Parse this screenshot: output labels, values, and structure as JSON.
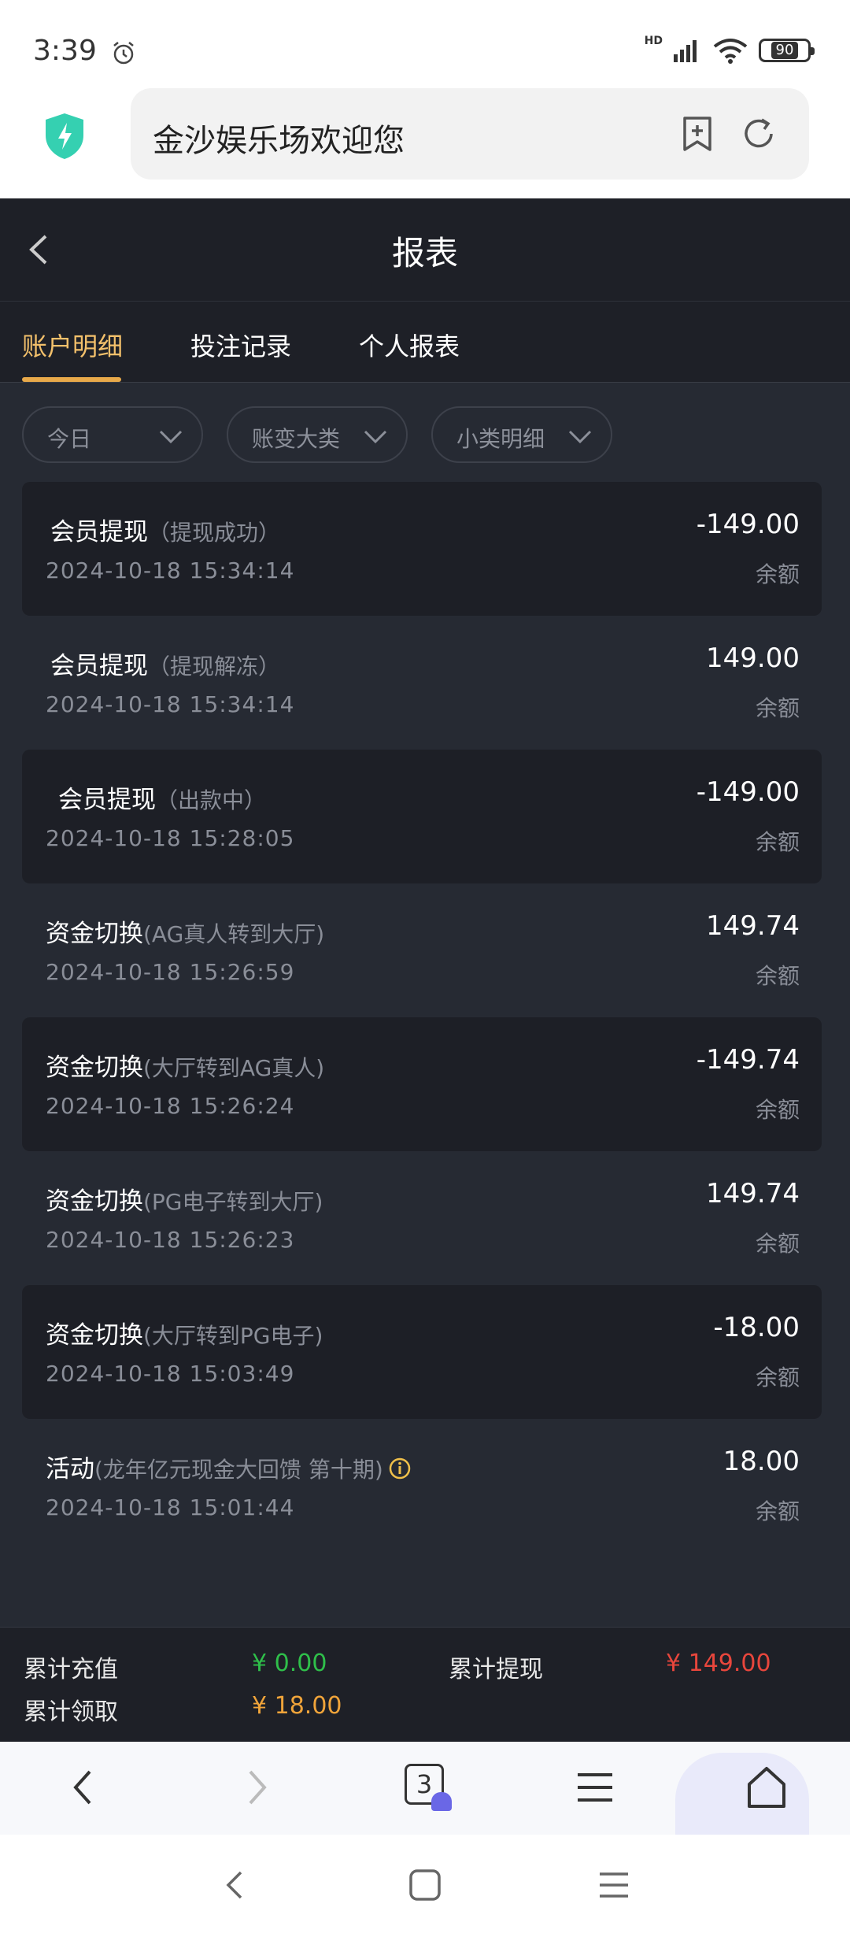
{
  "status_bar": {
    "time": "3:39",
    "network": "HD",
    "battery": "90"
  },
  "browser": {
    "address": "金沙娱乐场欢迎您",
    "tab_count": "3"
  },
  "header": {
    "title": "报表"
  },
  "tabs": [
    {
      "label": "账户明细",
      "active": true
    },
    {
      "label": "投注记录",
      "active": false
    },
    {
      "label": "个人报表",
      "active": false
    }
  ],
  "filters": [
    {
      "label": "今日"
    },
    {
      "label": "账变大类"
    },
    {
      "label": "小类明细"
    }
  ],
  "records": [
    {
      "title": "会员提现",
      "sub": "（提现成功）",
      "time": "2024-10-18 15:34:14",
      "amount": "-149.00",
      "balance": "余额"
    },
    {
      "title": "会员提现",
      "sub": "（提现解冻）",
      "time": "2024-10-18 15:34:14",
      "amount": "149.00",
      "balance": "余额"
    },
    {
      "title": "会员提现",
      "sub": "（出款中）",
      "time": "2024-10-18 15:28:05",
      "amount": "-149.00",
      "balance": "余额"
    },
    {
      "title": "资金切换",
      "sub": "(AG真人转到大厅)",
      "time": "2024-10-18 15:26:59",
      "amount": "149.74",
      "balance": "余额"
    },
    {
      "title": "资金切换",
      "sub": "(大厅转到AG真人)",
      "time": "2024-10-18 15:26:24",
      "amount": "-149.74",
      "balance": "余额"
    },
    {
      "title": "资金切换",
      "sub": "(PG电子转到大厅)",
      "time": "2024-10-18 15:26:23",
      "amount": "149.74",
      "balance": "余额"
    },
    {
      "title": "资金切换",
      "sub": "(大厅转到PG电子)",
      "time": "2024-10-18 15:03:49",
      "amount": "-18.00",
      "balance": "余额"
    },
    {
      "title": "活动",
      "sub": "(龙年亿元现金大回馈 第十期)",
      "time": "2024-10-18 15:01:44",
      "amount": "18.00",
      "balance": "余额"
    }
  ],
  "summary": {
    "recharge_label": "累计充值",
    "recharge_value": "¥ 0.00",
    "withdraw_label": "累计提现",
    "withdraw_value": "¥ 149.00",
    "claim_label": "累计领取",
    "claim_value": "¥ 18.00"
  },
  "colors": {
    "accent": "#f3c06b",
    "green": "#2fbf4a",
    "red": "#e8463c",
    "orange": "#f0a43a"
  }
}
